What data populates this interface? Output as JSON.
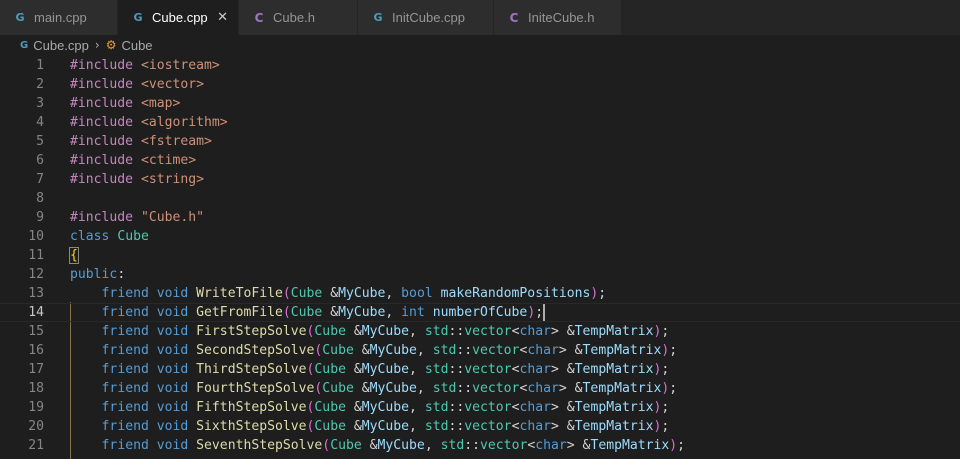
{
  "tabs": [
    {
      "label": "main.cpp",
      "icon": "cpp-file-icon",
      "active": false
    },
    {
      "label": "Cube.cpp",
      "icon": "cpp-file-icon",
      "active": true
    },
    {
      "label": "Cube.h",
      "icon": "c-header-icon",
      "active": false
    },
    {
      "label": "InitCube.cpp",
      "icon": "cpp-file-icon",
      "active": false
    },
    {
      "label": "IniteCube.h",
      "icon": "c-header-icon",
      "active": false
    }
  ],
  "breadcrumb": {
    "file": "Cube.cpp",
    "symbol": "Cube"
  },
  "editor": {
    "current_line": 14,
    "lines": [
      {
        "n": "1",
        "tokens": [
          [
            "pre",
            "#include "
          ],
          [
            "str",
            "<iostream>"
          ]
        ]
      },
      {
        "n": "2",
        "tokens": [
          [
            "pre",
            "#include "
          ],
          [
            "str",
            "<vector>"
          ]
        ]
      },
      {
        "n": "3",
        "tokens": [
          [
            "pre",
            "#include "
          ],
          [
            "str",
            "<map>"
          ]
        ]
      },
      {
        "n": "4",
        "tokens": [
          [
            "pre",
            "#include "
          ],
          [
            "str",
            "<algorithm>"
          ]
        ]
      },
      {
        "n": "5",
        "tokens": [
          [
            "pre",
            "#include "
          ],
          [
            "str",
            "<fstream>"
          ]
        ]
      },
      {
        "n": "6",
        "tokens": [
          [
            "pre",
            "#include "
          ],
          [
            "str",
            "<ctime>"
          ]
        ]
      },
      {
        "n": "7",
        "tokens": [
          [
            "pre",
            "#include "
          ],
          [
            "str",
            "<string>"
          ]
        ]
      },
      {
        "n": "8",
        "tokens": []
      },
      {
        "n": "9",
        "tokens": [
          [
            "pre",
            "#include "
          ],
          [
            "str",
            "\"Cube.h\""
          ]
        ]
      },
      {
        "n": "10",
        "tokens": [
          [
            "kw",
            "class "
          ],
          [
            "type",
            "Cube"
          ]
        ]
      },
      {
        "n": "11",
        "tokens": [
          [
            "b1",
            "{"
          ]
        ]
      },
      {
        "n": "12",
        "tokens": [
          [
            "kw",
            "public"
          ],
          [
            "p",
            ":"
          ]
        ]
      },
      {
        "n": "13",
        "tokens": [
          [
            "p",
            "    "
          ],
          [
            "kw",
            "friend "
          ],
          [
            "kw",
            "void "
          ],
          [
            "fn",
            "WriteToFile"
          ],
          [
            "b2",
            "("
          ],
          [
            "type",
            "Cube "
          ],
          [
            "p",
            "&"
          ],
          [
            "var",
            "MyCube"
          ],
          [
            "p",
            ", "
          ],
          [
            "kw",
            "bool "
          ],
          [
            "var",
            "makeRandomPositions"
          ],
          [
            "b2",
            ")"
          ],
          [
            "p",
            ";"
          ]
        ]
      },
      {
        "n": "14",
        "tokens": [
          [
            "p",
            "    "
          ],
          [
            "kw",
            "friend "
          ],
          [
            "kw",
            "void "
          ],
          [
            "fn",
            "GetFromFile"
          ],
          [
            "b2",
            "("
          ],
          [
            "type",
            "Cube "
          ],
          [
            "p",
            "&"
          ],
          [
            "var",
            "MyCube"
          ],
          [
            "p",
            ", "
          ],
          [
            "kw",
            "int "
          ],
          [
            "var",
            "numberOfCube"
          ],
          [
            "b2",
            ")"
          ],
          [
            "p",
            ";"
          ]
        ]
      },
      {
        "n": "15",
        "tokens": [
          [
            "p",
            "    "
          ],
          [
            "kw",
            "friend "
          ],
          [
            "kw",
            "void "
          ],
          [
            "fn",
            "FirstStepSolve"
          ],
          [
            "b2",
            "("
          ],
          [
            "type",
            "Cube "
          ],
          [
            "p",
            "&"
          ],
          [
            "var",
            "MyCube"
          ],
          [
            "p",
            ", "
          ],
          [
            "ns",
            "std"
          ],
          [
            "p",
            "::"
          ],
          [
            "type",
            "vector"
          ],
          [
            "p",
            "<"
          ],
          [
            "kw",
            "char"
          ],
          [
            "p",
            "> &"
          ],
          [
            "var",
            "TempMatrix"
          ],
          [
            "b2",
            ")"
          ],
          [
            "p",
            ";"
          ]
        ]
      },
      {
        "n": "16",
        "tokens": [
          [
            "p",
            "    "
          ],
          [
            "kw",
            "friend "
          ],
          [
            "kw",
            "void "
          ],
          [
            "fn",
            "SecondStepSolve"
          ],
          [
            "b2",
            "("
          ],
          [
            "type",
            "Cube "
          ],
          [
            "p",
            "&"
          ],
          [
            "var",
            "MyCube"
          ],
          [
            "p",
            ", "
          ],
          [
            "ns",
            "std"
          ],
          [
            "p",
            "::"
          ],
          [
            "type",
            "vector"
          ],
          [
            "p",
            "<"
          ],
          [
            "kw",
            "char"
          ],
          [
            "p",
            "> &"
          ],
          [
            "var",
            "TempMatrix"
          ],
          [
            "b2",
            ")"
          ],
          [
            "p",
            ";"
          ]
        ]
      },
      {
        "n": "17",
        "tokens": [
          [
            "p",
            "    "
          ],
          [
            "kw",
            "friend "
          ],
          [
            "kw",
            "void "
          ],
          [
            "fn",
            "ThirdStepSolve"
          ],
          [
            "b2",
            "("
          ],
          [
            "type",
            "Cube "
          ],
          [
            "p",
            "&"
          ],
          [
            "var",
            "MyCube"
          ],
          [
            "p",
            ", "
          ],
          [
            "ns",
            "std"
          ],
          [
            "p",
            "::"
          ],
          [
            "type",
            "vector"
          ],
          [
            "p",
            "<"
          ],
          [
            "kw",
            "char"
          ],
          [
            "p",
            "> &"
          ],
          [
            "var",
            "TempMatrix"
          ],
          [
            "b2",
            ")"
          ],
          [
            "p",
            ";"
          ]
        ]
      },
      {
        "n": "18",
        "tokens": [
          [
            "p",
            "    "
          ],
          [
            "kw",
            "friend "
          ],
          [
            "kw",
            "void "
          ],
          [
            "fn",
            "FourthStepSolve"
          ],
          [
            "b2",
            "("
          ],
          [
            "type",
            "Cube "
          ],
          [
            "p",
            "&"
          ],
          [
            "var",
            "MyCube"
          ],
          [
            "p",
            ", "
          ],
          [
            "ns",
            "std"
          ],
          [
            "p",
            "::"
          ],
          [
            "type",
            "vector"
          ],
          [
            "p",
            "<"
          ],
          [
            "kw",
            "char"
          ],
          [
            "p",
            "> &"
          ],
          [
            "var",
            "TempMatrix"
          ],
          [
            "b2",
            ")"
          ],
          [
            "p",
            ";"
          ]
        ]
      },
      {
        "n": "19",
        "tokens": [
          [
            "p",
            "    "
          ],
          [
            "kw",
            "friend "
          ],
          [
            "kw",
            "void "
          ],
          [
            "fn",
            "FifthStepSolve"
          ],
          [
            "b2",
            "("
          ],
          [
            "type",
            "Cube "
          ],
          [
            "p",
            "&"
          ],
          [
            "var",
            "MyCube"
          ],
          [
            "p",
            ", "
          ],
          [
            "ns",
            "std"
          ],
          [
            "p",
            "::"
          ],
          [
            "type",
            "vector"
          ],
          [
            "p",
            "<"
          ],
          [
            "kw",
            "char"
          ],
          [
            "p",
            "> &"
          ],
          [
            "var",
            "TempMatrix"
          ],
          [
            "b2",
            ")"
          ],
          [
            "p",
            ";"
          ]
        ]
      },
      {
        "n": "20",
        "tokens": [
          [
            "p",
            "    "
          ],
          [
            "kw",
            "friend "
          ],
          [
            "kw",
            "void "
          ],
          [
            "fn",
            "SixthStepSolve"
          ],
          [
            "b2",
            "("
          ],
          [
            "type",
            "Cube "
          ],
          [
            "p",
            "&"
          ],
          [
            "var",
            "MyCube"
          ],
          [
            "p",
            ", "
          ],
          [
            "ns",
            "std"
          ],
          [
            "p",
            "::"
          ],
          [
            "type",
            "vector"
          ],
          [
            "p",
            "<"
          ],
          [
            "kw",
            "char"
          ],
          [
            "p",
            "> &"
          ],
          [
            "var",
            "TempMatrix"
          ],
          [
            "b2",
            ")"
          ],
          [
            "p",
            ";"
          ]
        ]
      },
      {
        "n": "21",
        "tokens": [
          [
            "p",
            "    "
          ],
          [
            "kw",
            "friend "
          ],
          [
            "kw",
            "void "
          ],
          [
            "fn",
            "SeventhStepSolve"
          ],
          [
            "b2",
            "("
          ],
          [
            "type",
            "Cube "
          ],
          [
            "p",
            "&"
          ],
          [
            "var",
            "MyCube"
          ],
          [
            "p",
            ", "
          ],
          [
            "ns",
            "std"
          ],
          [
            "p",
            "::"
          ],
          [
            "type",
            "vector"
          ],
          [
            "p",
            "<"
          ],
          [
            "kw",
            "char"
          ],
          [
            "p",
            "> &"
          ],
          [
            "var",
            "TempMatrix"
          ],
          [
            "b2",
            ")"
          ],
          [
            "p",
            ";"
          ]
        ]
      }
    ]
  }
}
